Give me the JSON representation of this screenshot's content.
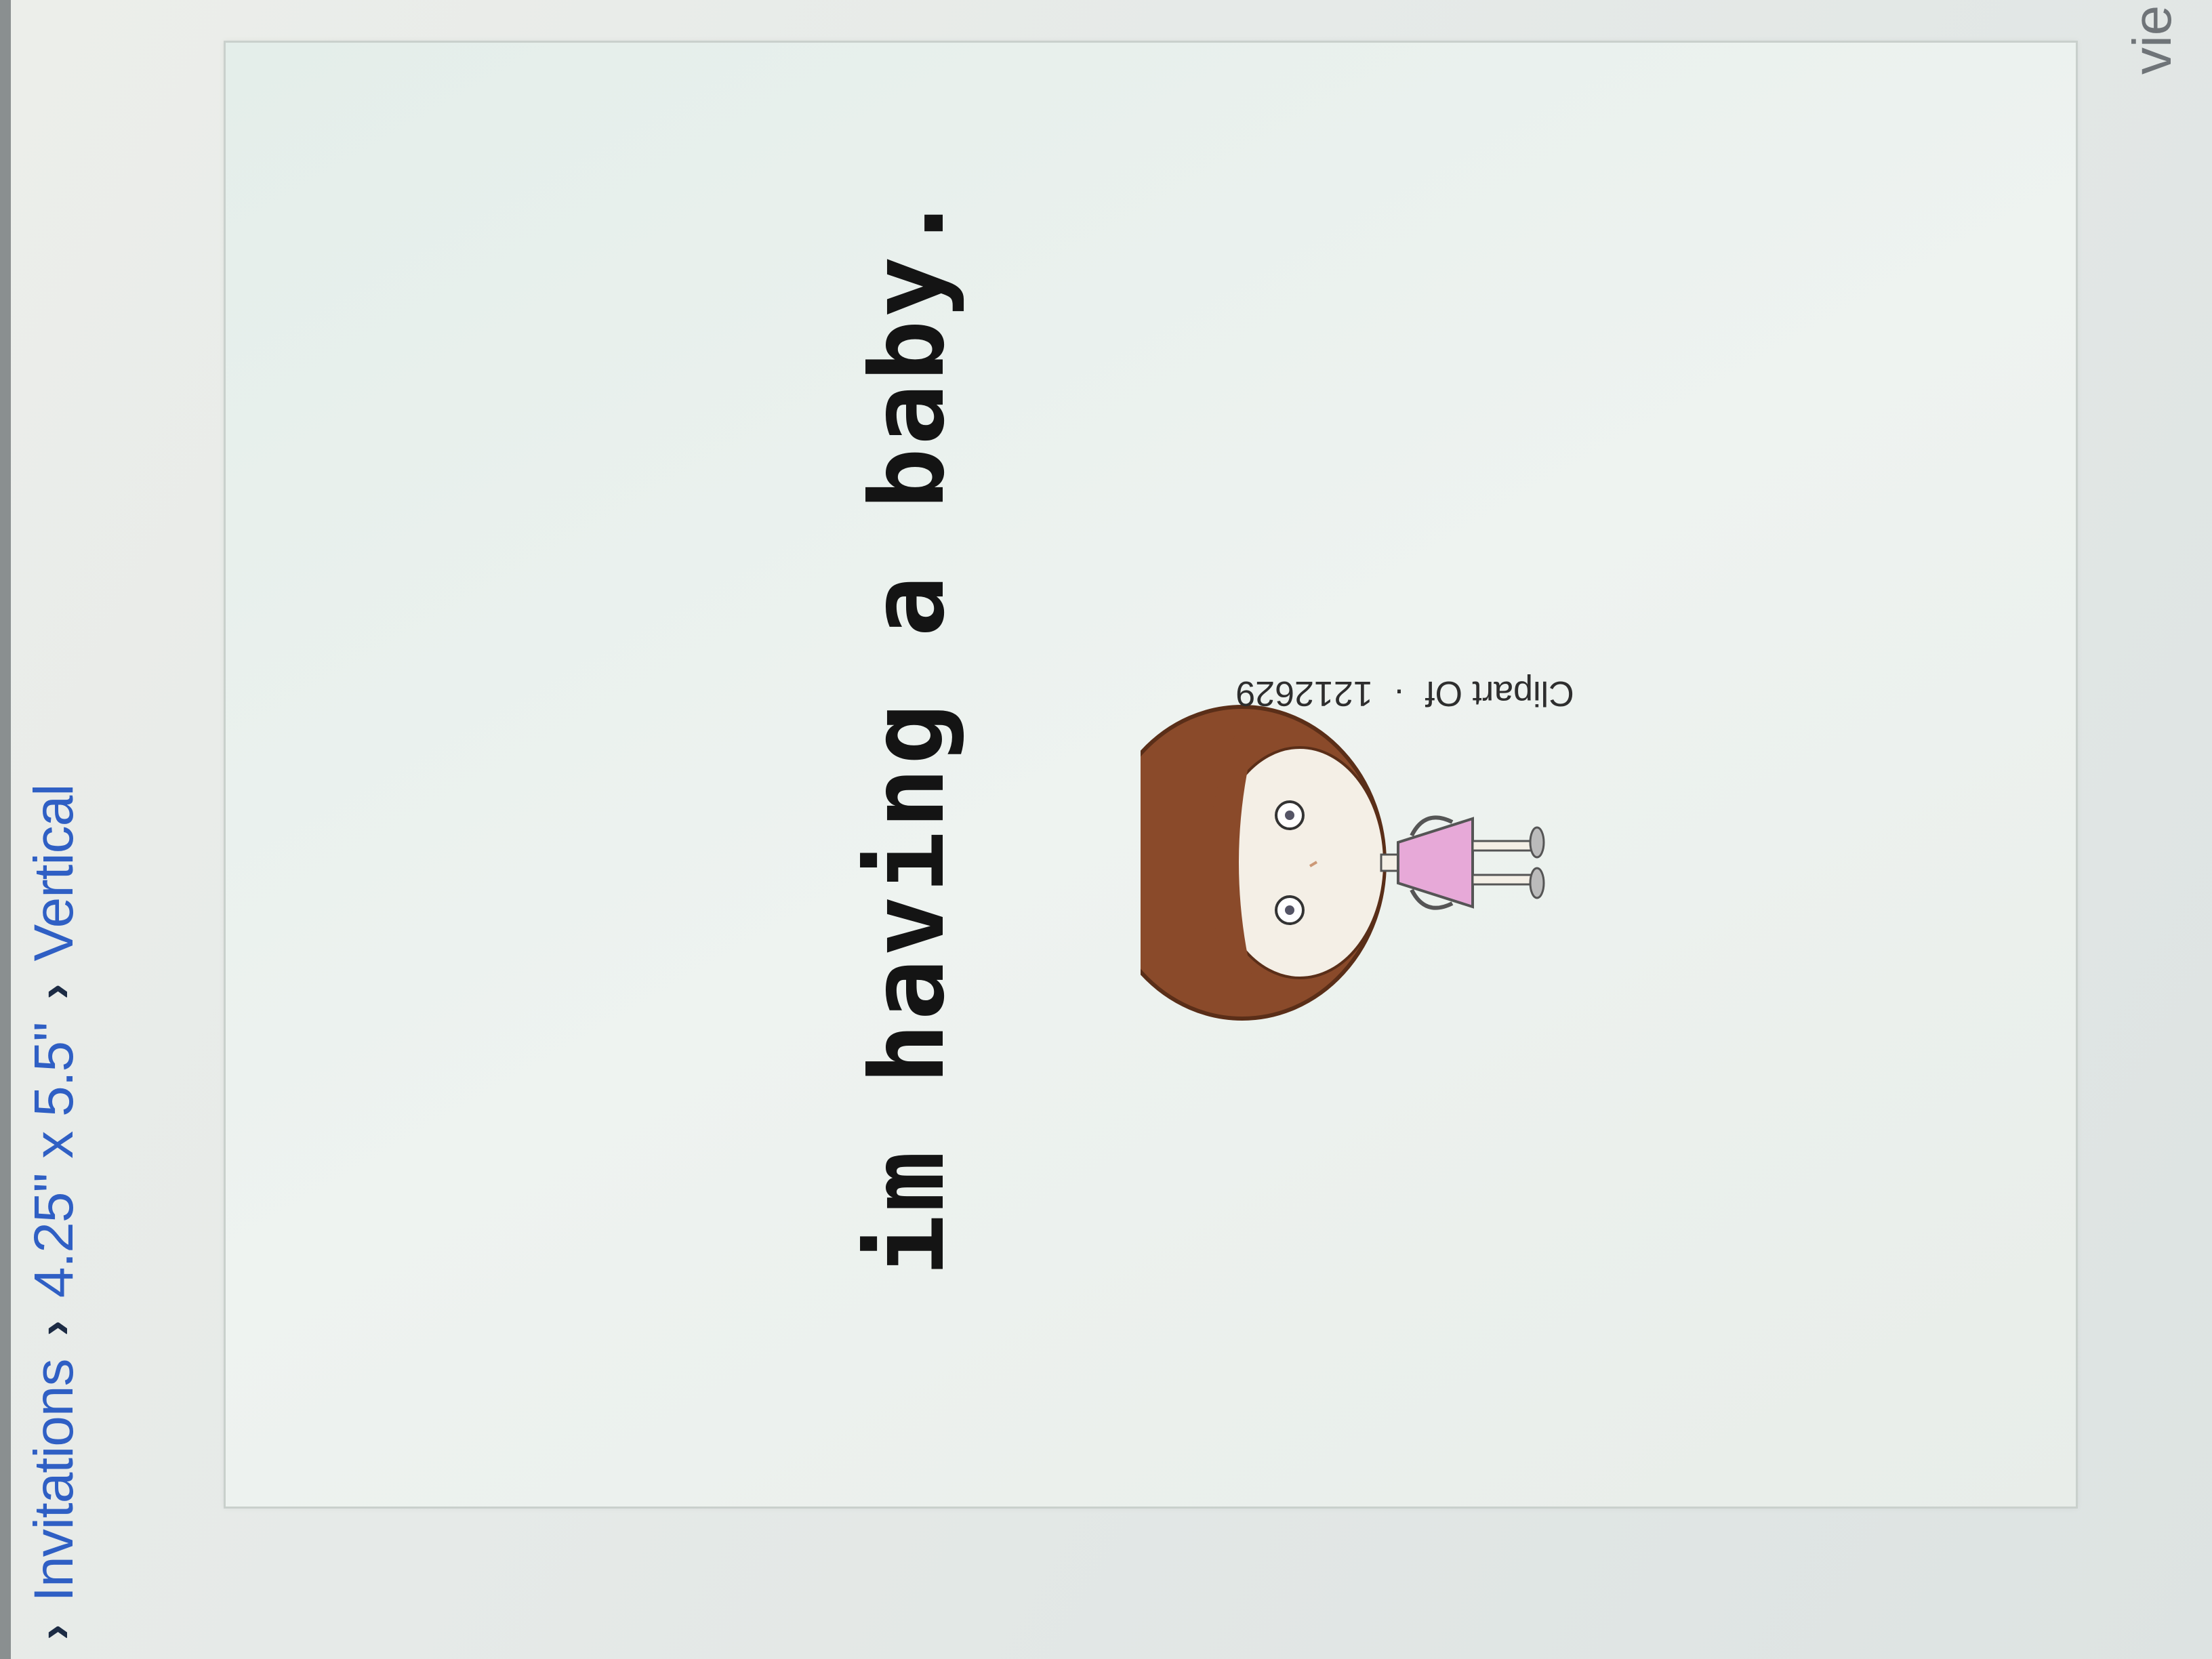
{
  "breadcrumb": {
    "items": [
      {
        "label": "Invitations"
      },
      {
        "label": "4.25\" x 5.5\""
      },
      {
        "label": "Vertical"
      }
    ],
    "separator": "›"
  },
  "card": {
    "headline": "im having a baby.",
    "clipart": {
      "icon": "girl-figure-icon",
      "credit_source": "Clipart Of",
      "credit_dot": "·",
      "credit_id": "1212629"
    }
  },
  "side_label": "vie",
  "colors": {
    "link": "#2f5fc4",
    "hair": "#8a4a2a",
    "dress": "#e7a9d8"
  }
}
